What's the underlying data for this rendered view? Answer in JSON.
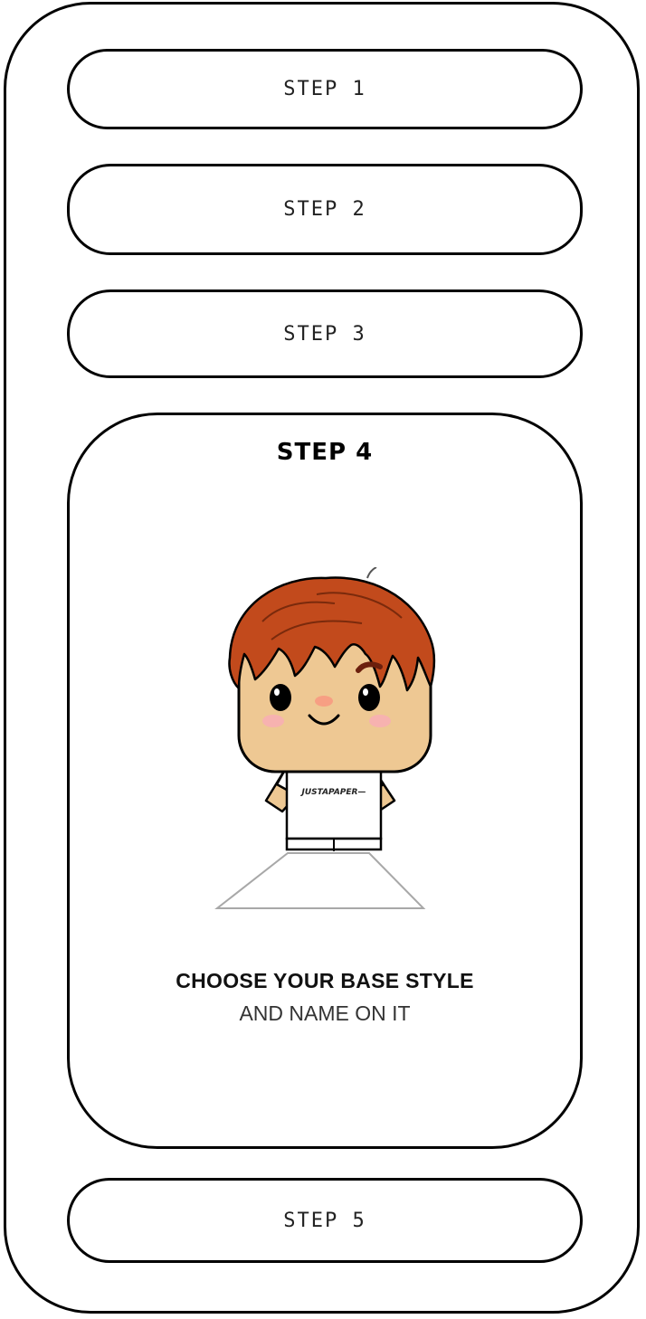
{
  "steps": [
    {
      "label": "STEP 1"
    },
    {
      "label": "STEP 2"
    },
    {
      "label": "STEP 3"
    },
    {
      "label": "STEP 4"
    },
    {
      "label": "STEP 5"
    }
  ],
  "active_step": {
    "title": "STEP 4",
    "heading": "CHOOSE YOUR BASE STYLE",
    "subheading": "AND NAME ON IT",
    "shirt_text": "JUSTAPAPER—"
  },
  "colors": {
    "border": "#000000",
    "hair": "#c24a1c",
    "skin": "#eec893",
    "blush": "#f7b2b0",
    "background": "#ffffff"
  }
}
